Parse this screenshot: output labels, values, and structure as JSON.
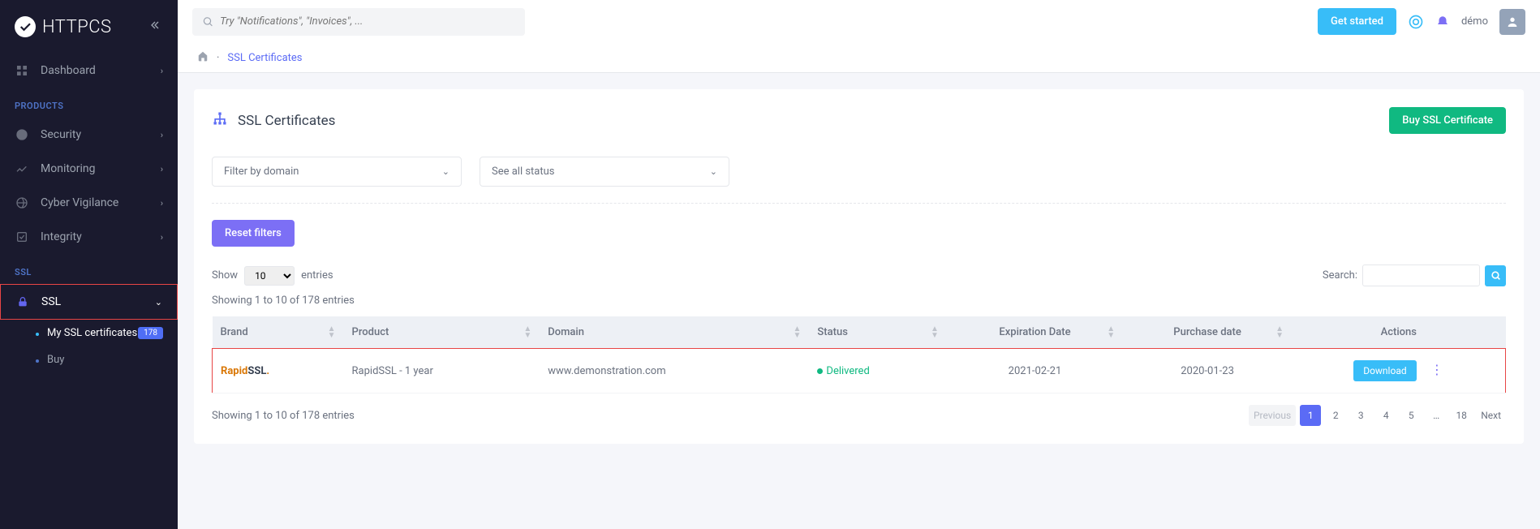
{
  "logo": "HTTPCS",
  "search_placeholder": "Try \"Notifications\", \"Invoices\", ...",
  "topbar": {
    "get_started": "Get started",
    "username": "démo"
  },
  "sidebar": {
    "dashboard": "Dashboard",
    "heading_products": "PRODUCTS",
    "security": "Security",
    "monitoring": "Monitoring",
    "cyber_vigilance": "Cyber Vigilance",
    "integrity": "Integrity",
    "heading_ssl": "SSL",
    "ssl": "SSL",
    "my_ssl": "My SSL certificates",
    "my_ssl_badge": "178",
    "buy": "Buy"
  },
  "breadcrumb": "SSL Certificates",
  "page": {
    "title": "SSL Certificates",
    "buy_btn": "Buy SSL Certificate",
    "filter_domain": "Filter by domain",
    "filter_status": "See all status",
    "reset": "Reset filters",
    "show": "Show",
    "entries": "entries",
    "entries_val": "10",
    "search_label": "Search:",
    "info": "Showing 1 to 10 of 178 entries",
    "cols": {
      "brand": "Brand",
      "product": "Product",
      "domain": "Domain",
      "status": "Status",
      "expiration": "Expiration Date",
      "purchase": "Purchase date",
      "actions": "Actions"
    },
    "row": {
      "brand_a": "Rapid",
      "brand_b": "SSL",
      "brand_dot": ".",
      "product": "RapidSSL - 1 year",
      "domain": "www.demonstration.com",
      "status": "Delivered",
      "expiration": "2021-02-21",
      "purchase": "2020-01-23",
      "download": "Download"
    },
    "pager": {
      "prev": "Previous",
      "next": "Next",
      "pages": [
        "1",
        "2",
        "3",
        "4",
        "5",
        "…",
        "18"
      ]
    }
  }
}
